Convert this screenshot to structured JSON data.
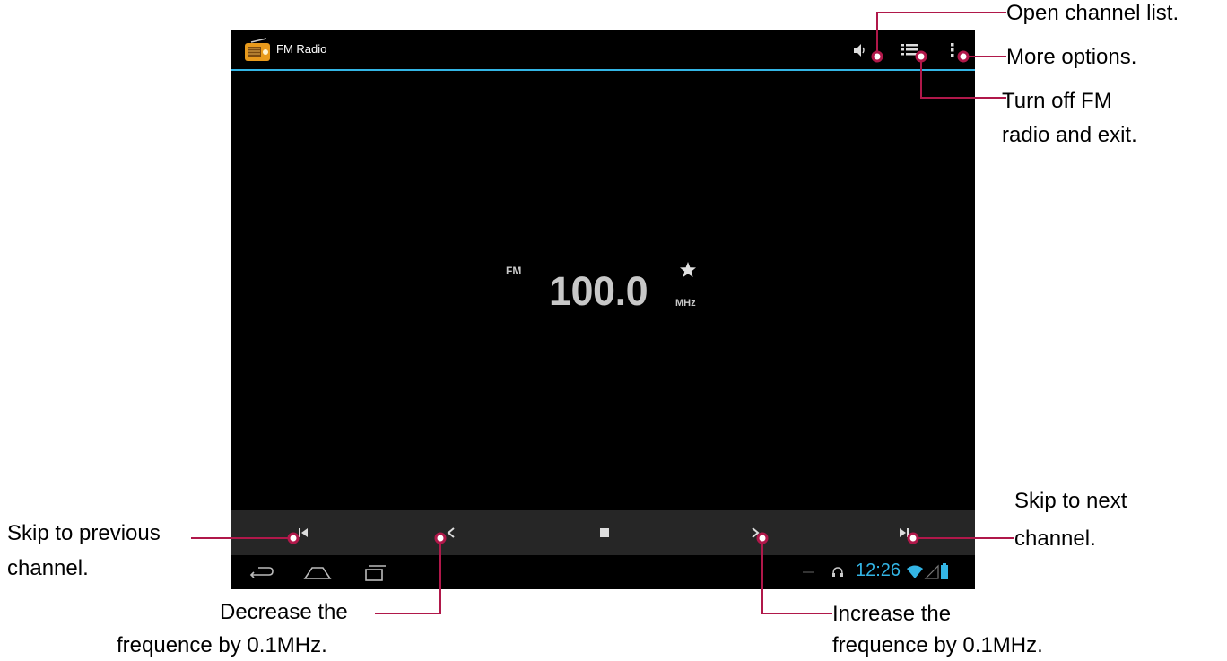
{
  "app": {
    "title": "FM Radio",
    "accent_color": "#33b5e5",
    "actionbar_icons": [
      "speaker-icon",
      "channel-list-icon",
      "overflow-menu-icon"
    ]
  },
  "tuner": {
    "band": "FM",
    "frequency": "100.0",
    "unit": "MHz",
    "favorite_icon": "star-icon"
  },
  "controls": [
    "skip-previous-icon",
    "decrease-frequency-icon",
    "stop-icon",
    "increase-frequency-icon",
    "skip-next-icon"
  ],
  "statusbar": {
    "time": "12:26",
    "icons": [
      "headset-icon",
      "wifi-icon",
      "signal-icon",
      "battery-icon"
    ]
  },
  "navbar": [
    "back-icon",
    "home-icon",
    "recent-apps-icon"
  ],
  "callouts": {
    "open_channel_list": "Open channel list.",
    "more_options": "More options.",
    "turn_off_line1": "Turn off FM",
    "turn_off_line2": "radio and exit.",
    "skip_next_line1": "Skip to next",
    "skip_next_line2": "channel.",
    "skip_prev_line1": "Skip to previous",
    "skip_prev_line2": "channel.",
    "decrease_line1": "Decrease the",
    "decrease_line2": "frequence by 0.1MHz.",
    "increase_line1": "Increase the",
    "increase_line2": "frequence by 0.1MHz."
  },
  "callout_color": "#b0184a"
}
